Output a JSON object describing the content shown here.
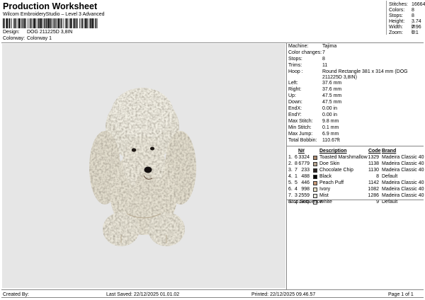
{
  "header": {
    "title": "Production Worksheet",
    "software": "Wilcom EmbroideryStudio – Level 3 Advanced",
    "design_label": "Design:",
    "design_value": "DOG 211225D 3,8IN",
    "colorway_label": "Colorway:",
    "colorway_value": "Colorway 1"
  },
  "stats": [
    {
      "label": "Stitches:",
      "value": "16664"
    },
    {
      "label": "Colors:",
      "value": "8"
    },
    {
      "label": "Stops:",
      "value": "8"
    },
    {
      "label": "Height:",
      "value": "3.74 in"
    },
    {
      "label": "Width:",
      "value": "2.96 in"
    },
    {
      "label": "Zoom:",
      "value": "1:1"
    }
  ],
  "machine": [
    {
      "label": "Machine:",
      "value": "Tajima"
    },
    {
      "label": "Color changes:",
      "value": "7"
    },
    {
      "label": "Stops:",
      "value": "8"
    },
    {
      "label": "Trims:",
      "value": "11"
    },
    {
      "label": "Hoop :",
      "value": "Round Rectangle 381 x 314 mm (DOG 211225D 3,8IN)"
    },
    {
      "label": "Left:",
      "value": "37.6 mm"
    },
    {
      "label": "Right:",
      "value": "37.6 mm"
    },
    {
      "label": "Up:",
      "value": "47.5 mm"
    },
    {
      "label": "Down:",
      "value": "47.5 mm"
    },
    {
      "label": "EndX:",
      "value": "0.00 in"
    },
    {
      "label": "EndY:",
      "value": "0.00 in"
    },
    {
      "label": "Max Stitch:",
      "value": "9.8 mm"
    },
    {
      "label": "Min Stitch:",
      "value": "0.1 mm"
    },
    {
      "label": "Max Jump:",
      "value": "6.9 mm"
    },
    {
      "label": "Total Bobbin:",
      "value": "110.67ft"
    }
  ],
  "color_table": {
    "headers": {
      "n": "N#",
      "description": "Description",
      "code": "Code",
      "brand": "Brand"
    },
    "rows": [
      {
        "idx": "1.",
        "n": "6",
        "num": "3324",
        "color": "#a8876d",
        "description": "Toasted Marshmallow",
        "code": "1329",
        "brand": "Madeira Classic 40"
      },
      {
        "idx": "2.",
        "n": "8",
        "num": "6779",
        "color": "#b8a590",
        "description": "Doe Skin",
        "code": "1138",
        "brand": "Madeira Classic 40"
      },
      {
        "idx": "3.",
        "n": "7",
        "num": "233",
        "color": "#2a2220",
        "description": "Chocolate Chip",
        "code": "1130",
        "brand": "Madeira Classic 40"
      },
      {
        "idx": "4.",
        "n": "1",
        "num": "488",
        "color": "#000000",
        "description": "Black",
        "code": "8",
        "brand": "Default"
      },
      {
        "idx": "5.",
        "n": "5",
        "num": "446",
        "color": "#c99a78",
        "description": "Peach Puff",
        "code": "1142",
        "brand": "Madeira Classic 40"
      },
      {
        "idx": "6.",
        "n": "4",
        "num": "998",
        "color": "#e7dfc6",
        "description": "Ivory",
        "code": "1082",
        "brand": "Madeira Classic 40"
      },
      {
        "idx": "7.",
        "n": "3",
        "num": "2559",
        "color": "#e4e4dc",
        "description": "Mist",
        "code": "1286",
        "brand": "Madeira Classic 40"
      },
      {
        "idx": "8.",
        "n": "2",
        "num": "1835",
        "color": "#ffffff",
        "description": "White",
        "code": "9",
        "brand": "Default"
      }
    ]
  },
  "stop_sequence_label": "Stop Sequence:",
  "footer": {
    "created_by": "Created By:",
    "last_saved": "Last Saved: 22/12/2025 01.01.02",
    "printed": "Printed: 22/12/2025 09.46.57",
    "page": "Page 1 of 1"
  }
}
